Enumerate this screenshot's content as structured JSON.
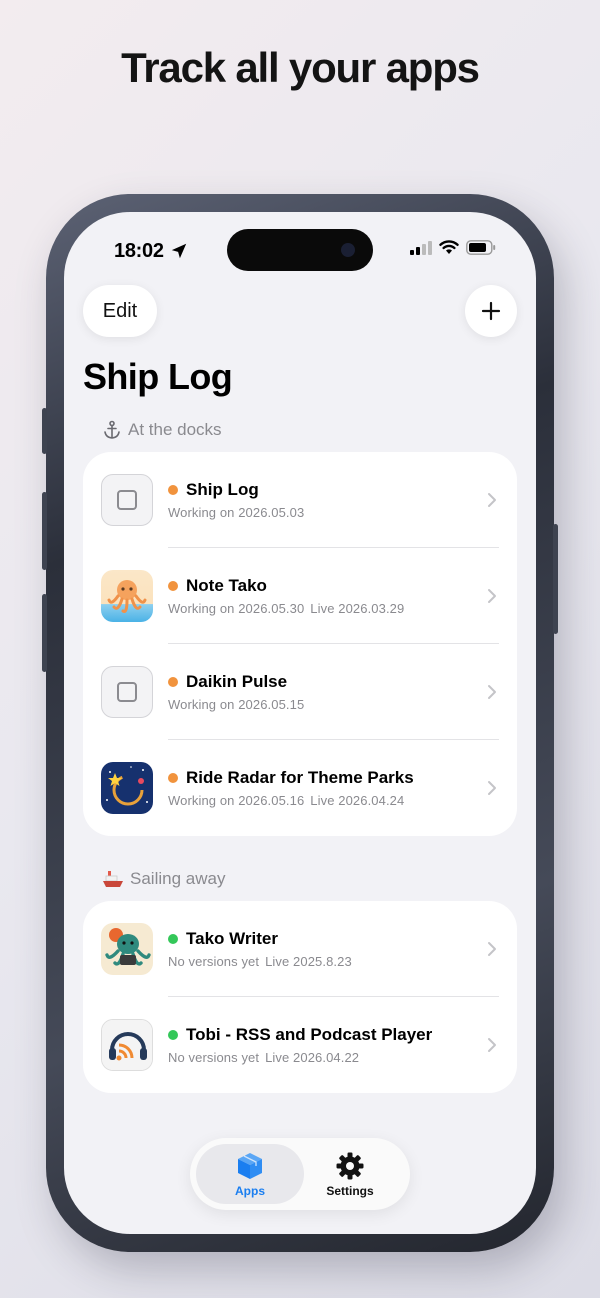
{
  "headline": "Track all your apps",
  "status_bar": {
    "time": "18:02"
  },
  "nav": {
    "edit_label": "Edit",
    "page_title": "Ship Log"
  },
  "sections": [
    {
      "header": "At the docks",
      "items": [
        {
          "name": "Ship Log",
          "working": "Working on 2026.05.03",
          "live": "",
          "status_color": "#f1933d"
        },
        {
          "name": "Note Tako",
          "working": "Working on 2026.05.30",
          "live": "Live 2026.03.29",
          "status_color": "#f1933d"
        },
        {
          "name": "Daikin Pulse",
          "working": "Working on 2026.05.15",
          "live": "",
          "status_color": "#f1933d"
        },
        {
          "name": "Ride Radar for Theme Parks",
          "working": "Working on 2026.05.16",
          "live": "Live 2026.04.24",
          "status_color": "#f1933d"
        }
      ]
    },
    {
      "header": "Sailing away",
      "items": [
        {
          "name": "Tako Writer",
          "working": "No versions yet",
          "live": "Live 2025.8.23",
          "status_color": "#34c759"
        },
        {
          "name": "Tobi - RSS and Podcast Player",
          "working": "No versions yet",
          "live": "Live 2026.04.22",
          "status_color": "#34c759"
        }
      ]
    }
  ],
  "tabbar": {
    "apps_label": "Apps",
    "settings_label": "Settings"
  },
  "colors": {
    "accent": "#1a7ef0",
    "working": "#f1933d",
    "live": "#34c759"
  },
  "icons": [
    "location-arrow-icon",
    "signal-icon",
    "wifi-icon",
    "battery-icon",
    "plus-icon",
    "anchor-icon",
    "ship-icon",
    "chevron-right-icon",
    "box-icon",
    "gear-icon"
  ]
}
